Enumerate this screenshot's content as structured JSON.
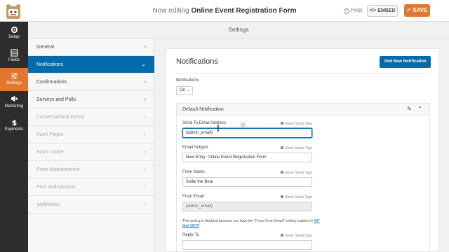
{
  "header": {
    "editing_prefix": "Now editing",
    "form_name": "Online Event Registration Form",
    "help_label": "Help",
    "embed_label": "</> EMBED",
    "save_label": "SAVE"
  },
  "leftnav": [
    {
      "label": "Setup",
      "icon": "gear-icon"
    },
    {
      "label": "Fields",
      "icon": "fields-icon"
    },
    {
      "label": "Settings",
      "icon": "sliders-icon"
    },
    {
      "label": "Marketing",
      "icon": "megaphone-icon"
    },
    {
      "label": "Payments",
      "icon": "dollar-icon"
    }
  ],
  "settings_title": "Settings",
  "submenu": [
    {
      "label": "General"
    },
    {
      "label": "Notifications"
    },
    {
      "label": "Confirmations"
    },
    {
      "label": "Surveys and Polls"
    },
    {
      "label": "Conversational Forms"
    },
    {
      "label": "Form Pages"
    },
    {
      "label": "Form Locker"
    },
    {
      "label": "Form Abandonment"
    },
    {
      "label": "Post Submissions"
    },
    {
      "label": "Webhooks"
    }
  ],
  "panel": {
    "title": "Notifications",
    "add_button": "Add New Notification",
    "notifications_label": "Notifications",
    "notifications_value": "On",
    "block_title": "Default Notification",
    "smart_tags": "Show Smart Tags",
    "fields": [
      {
        "label": "Send To Email Address",
        "value": "{admin_email}"
      },
      {
        "label": "Email Subject",
        "value": "New Entry: Online Event Registration Form"
      },
      {
        "label": "From Name",
        "value": "Sullie the Bear"
      },
      {
        "label": "From Email",
        "value": "{admin_email}"
      },
      {
        "label": "Reply-To",
        "value": ""
      }
    ],
    "note_before": "This setting is disabled because you have the \"Force From Email\" setting enabled in",
    "note_link": "WP Mail SMTP",
    "note_after": "."
  },
  "colors": {
    "accent_orange": "#e27730",
    "accent_blue": "#036aab",
    "sidebar_dark": "#2d2d2d"
  }
}
